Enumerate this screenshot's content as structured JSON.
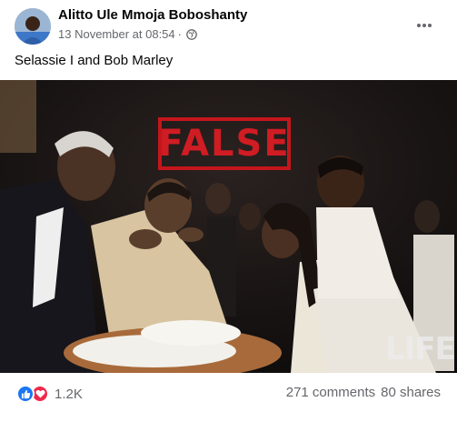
{
  "post": {
    "author": "Alitto Ule Mmoja Boboshanty",
    "timestamp": "13 November at 08:54",
    "separator": "·",
    "audience_icon": "globe-icon",
    "more_icon": "more-horizontal-icon",
    "caption": "Selassie I and Bob Marley"
  },
  "image": {
    "stamp_text": "FALSE",
    "watermark": "LIFE",
    "stamp_color": "#c4161c"
  },
  "footer": {
    "reaction_icons": [
      "like-icon",
      "love-icon"
    ],
    "reaction_count": "1.2K",
    "comments": "271 comments",
    "shares": "80 shares"
  },
  "colors": {
    "like": "#1877f2",
    "love": "#f02849",
    "secondary_text": "#65676b"
  }
}
